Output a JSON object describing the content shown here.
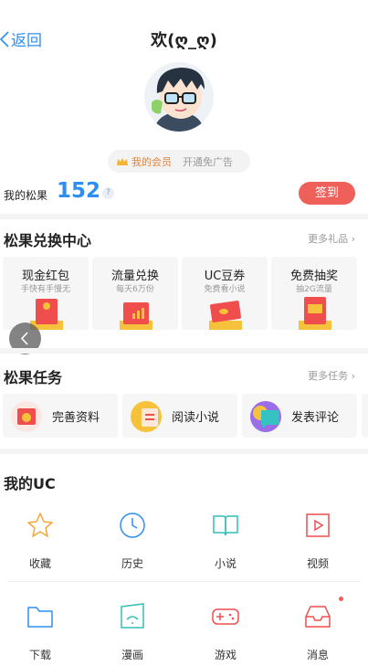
{
  "header": {
    "back_label": "返回",
    "title": "欢(ღ_ღ)"
  },
  "member": {
    "vip_label": "我的会员",
    "noads_label": "开通免广告"
  },
  "pinecone": {
    "label": "我的松果",
    "count": "152",
    "help": "?",
    "signin_label": "签到"
  },
  "exchange": {
    "title": "松果兑换中心",
    "more": "更多礼品",
    "cards": [
      {
        "title": "现金红包",
        "subtitle": "手快有手慢无",
        "icon": "red-envelope-icon"
      },
      {
        "title": "流量兑换",
        "subtitle": "每天6万份",
        "icon": "data-traffic-icon"
      },
      {
        "title": "UC豆券",
        "subtitle": "免费看小说",
        "icon": "coupon-icon"
      },
      {
        "title": "免费抽奖",
        "subtitle": "抽2G流量",
        "icon": "lottery-icon"
      }
    ]
  },
  "tasks": {
    "title": "松果任务",
    "more": "更多任务",
    "items": [
      {
        "label": "完善资料",
        "icon": "profile-card-icon"
      },
      {
        "label": "阅读小说",
        "icon": "read-novel-icon"
      },
      {
        "label": "发表评论",
        "icon": "comment-icon"
      }
    ]
  },
  "my_uc": {
    "title": "我的UC",
    "items": [
      {
        "label": "收藏",
        "icon": "star-icon"
      },
      {
        "label": "历史",
        "icon": "clock-icon"
      },
      {
        "label": "小说",
        "icon": "book-icon"
      },
      {
        "label": "视频",
        "icon": "video-icon"
      },
      {
        "label": "下载",
        "icon": "folder-icon"
      },
      {
        "label": "漫画",
        "icon": "comic-icon"
      },
      {
        "label": "游戏",
        "icon": "gamepad-icon"
      },
      {
        "label": "消息",
        "icon": "inbox-icon"
      }
    ]
  },
  "colors": {
    "accent": "#2f8ff0",
    "signin": "#f0605b",
    "vip": "#e0843a"
  }
}
